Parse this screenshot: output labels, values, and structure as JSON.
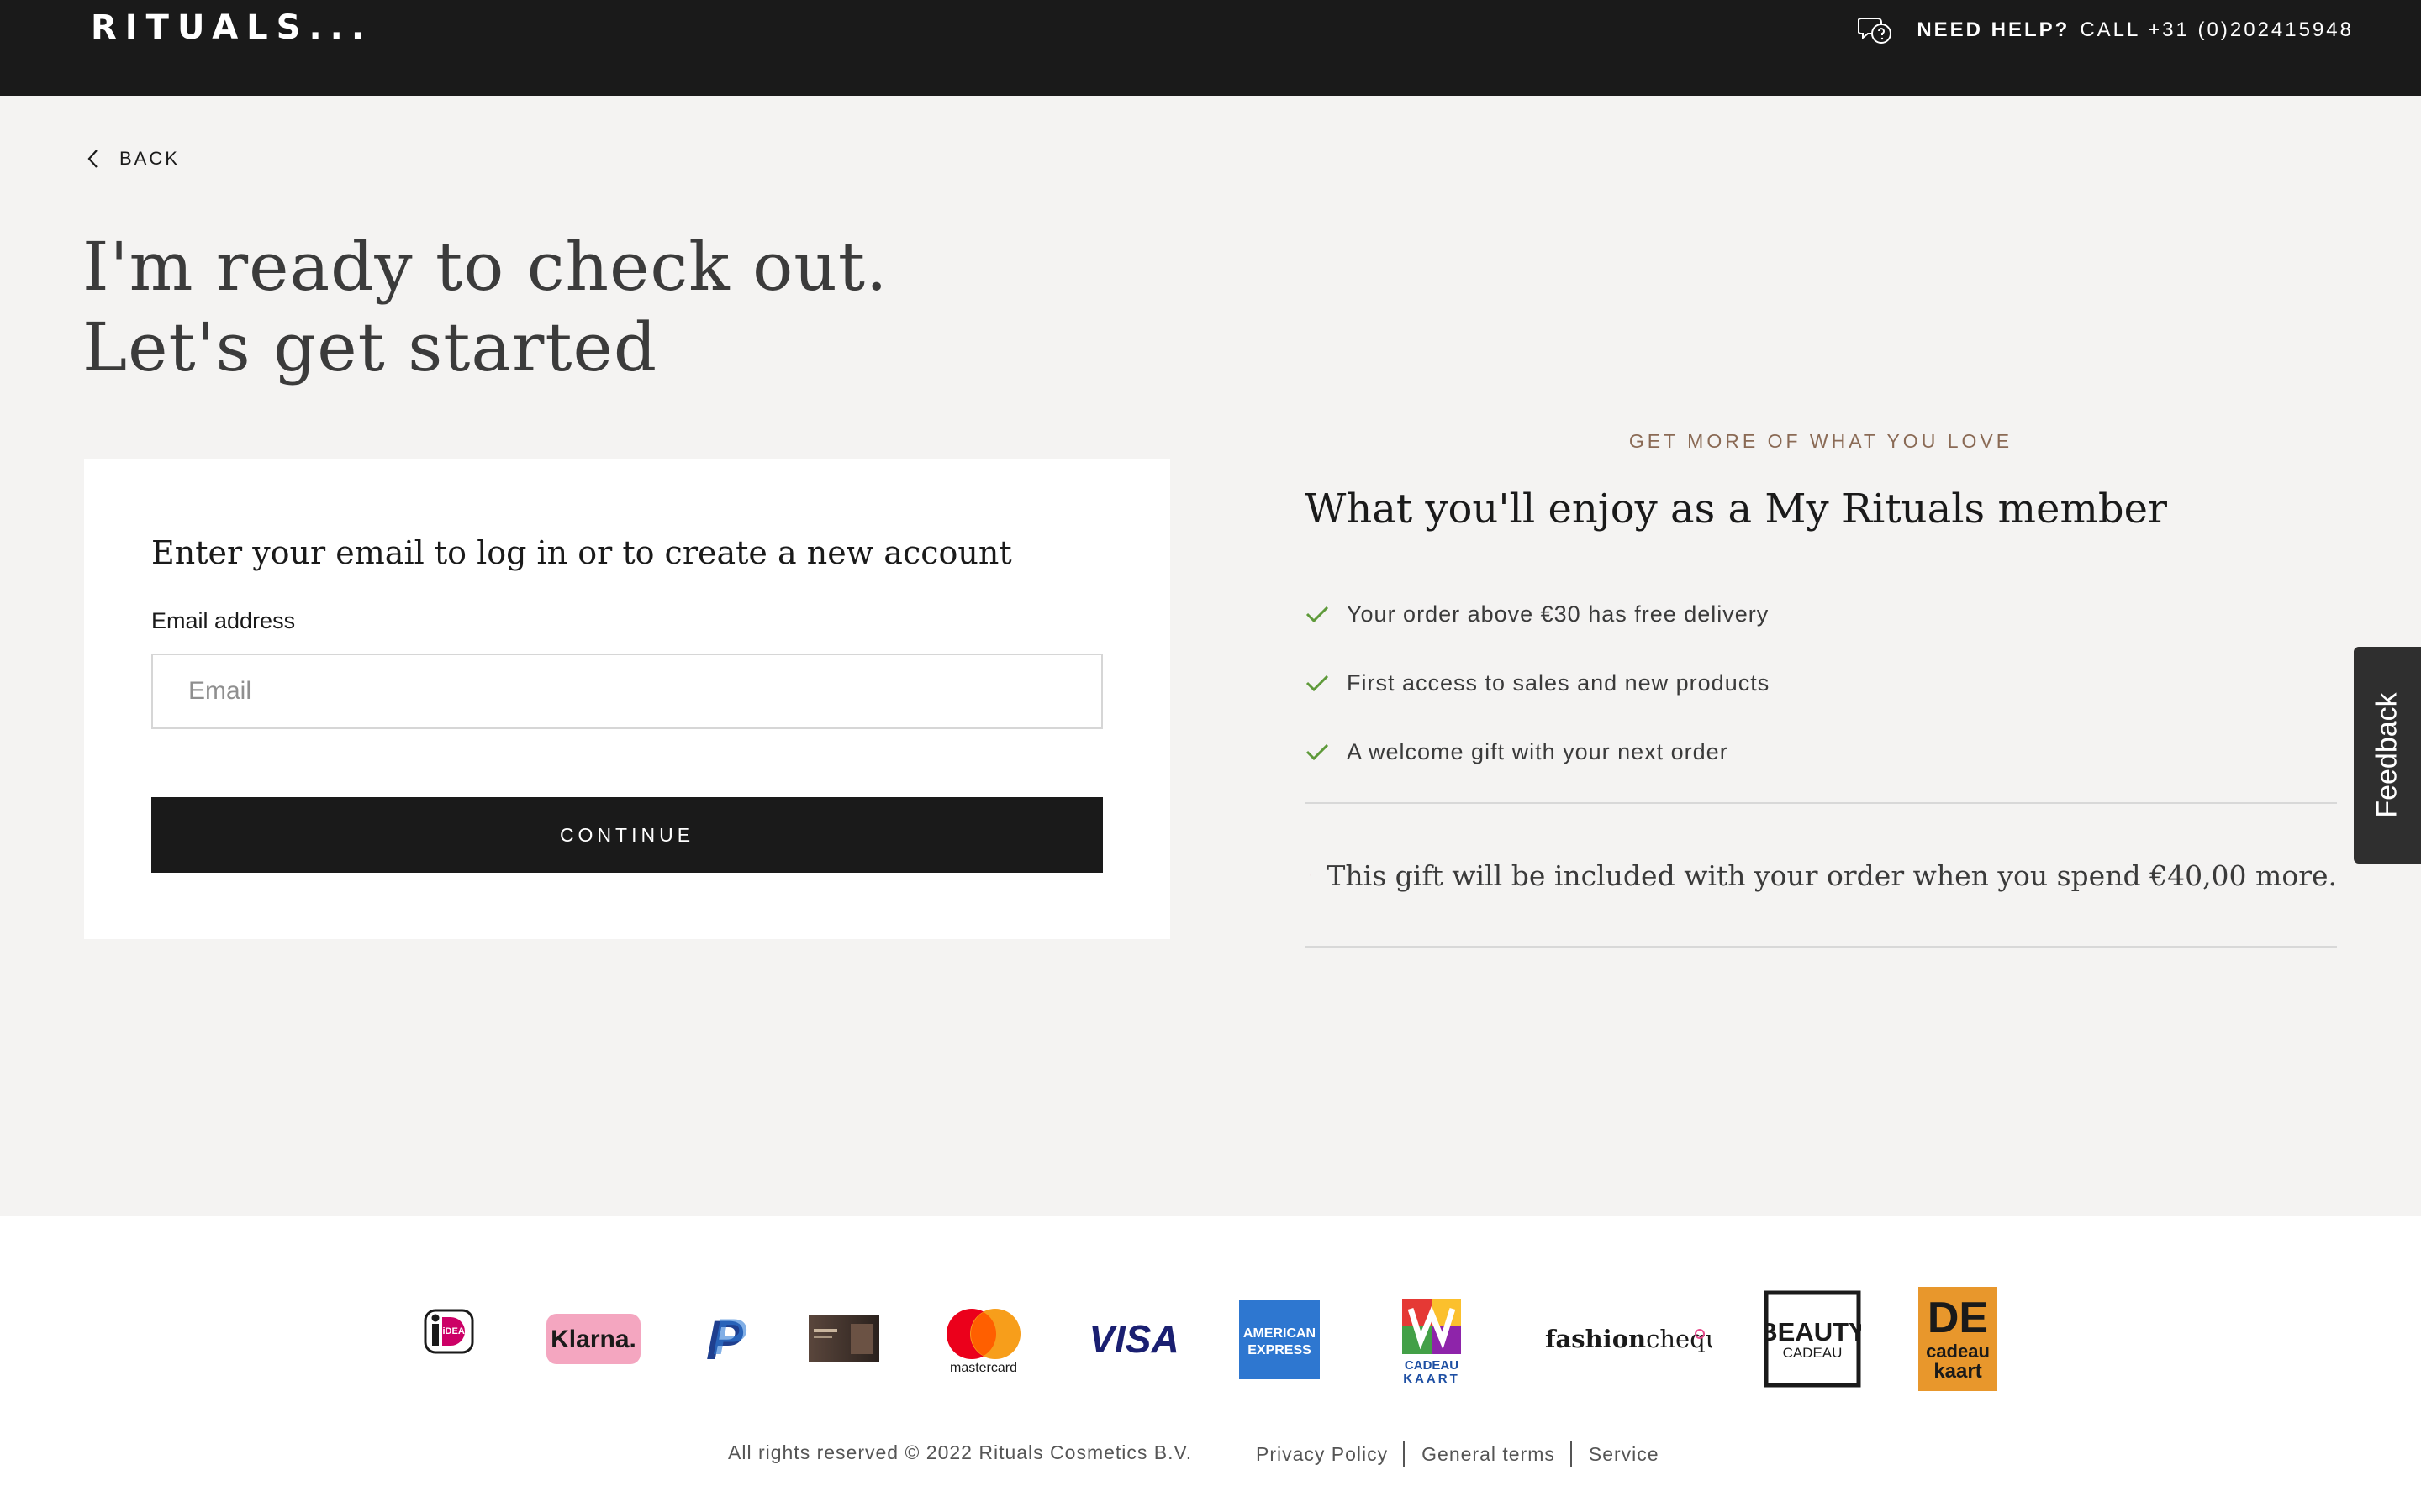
{
  "header": {
    "logo_text": "RITUALS...",
    "help_strong": "NEED HELP?",
    "help_text": "CALL +31 (0)202415948",
    "help_icon": "chat-question-icon"
  },
  "nav": {
    "back_label": "BACK",
    "back_icon": "chevron-left-icon"
  },
  "page": {
    "title_line1": "I'm ready to check out.",
    "title_line2": "Let's get started"
  },
  "login_card": {
    "title": "Enter your email to log in or to create a new account",
    "email_label": "Email address",
    "email_placeholder": "Email",
    "email_value": "",
    "continue_label": "CONTINUE"
  },
  "member": {
    "kicker": "GET MORE OF WHAT YOU LOVE",
    "title": "What you'll enjoy as a My Rituals member",
    "benefits": [
      "Your order above €30 has free delivery",
      "First access to sales and new products",
      "A welcome gift with your next order"
    ],
    "gift_text": "This gift will be included with your order when you spend €40,00 more."
  },
  "feedback_label": "Feedback",
  "payment_methods": {
    "ideal": "iDEAL",
    "klarna": "Klarna.",
    "paypal": "P",
    "giftcard": "Rituals gift card",
    "mastercard": "mastercard",
    "visa": "VISA",
    "amex_line1": "AMERICAN",
    "amex_line2": "EXPRESS",
    "vvv_line1": "CADEAU",
    "vvv_line2": "KAART",
    "fashioncheque_bold": "fashion",
    "fashioncheque_light": "cheque",
    "beauty_line1": "BEAUTY",
    "beauty_line2": "CADEAU",
    "de_logo": "DE",
    "de_line1": "cadeau",
    "de_line2": "kaart"
  },
  "footer": {
    "copyright": "All rights reserved © 2022 Rituals Cosmetics B.V.",
    "links": [
      "Privacy Policy",
      "General terms",
      "Service"
    ]
  },
  "colors": {
    "topbar": "#1a1a1a",
    "page_bg": "#f4f3f2",
    "check_green": "#5e9a3a",
    "kicker": "#8a6a55",
    "button": "#1a1a1a"
  }
}
